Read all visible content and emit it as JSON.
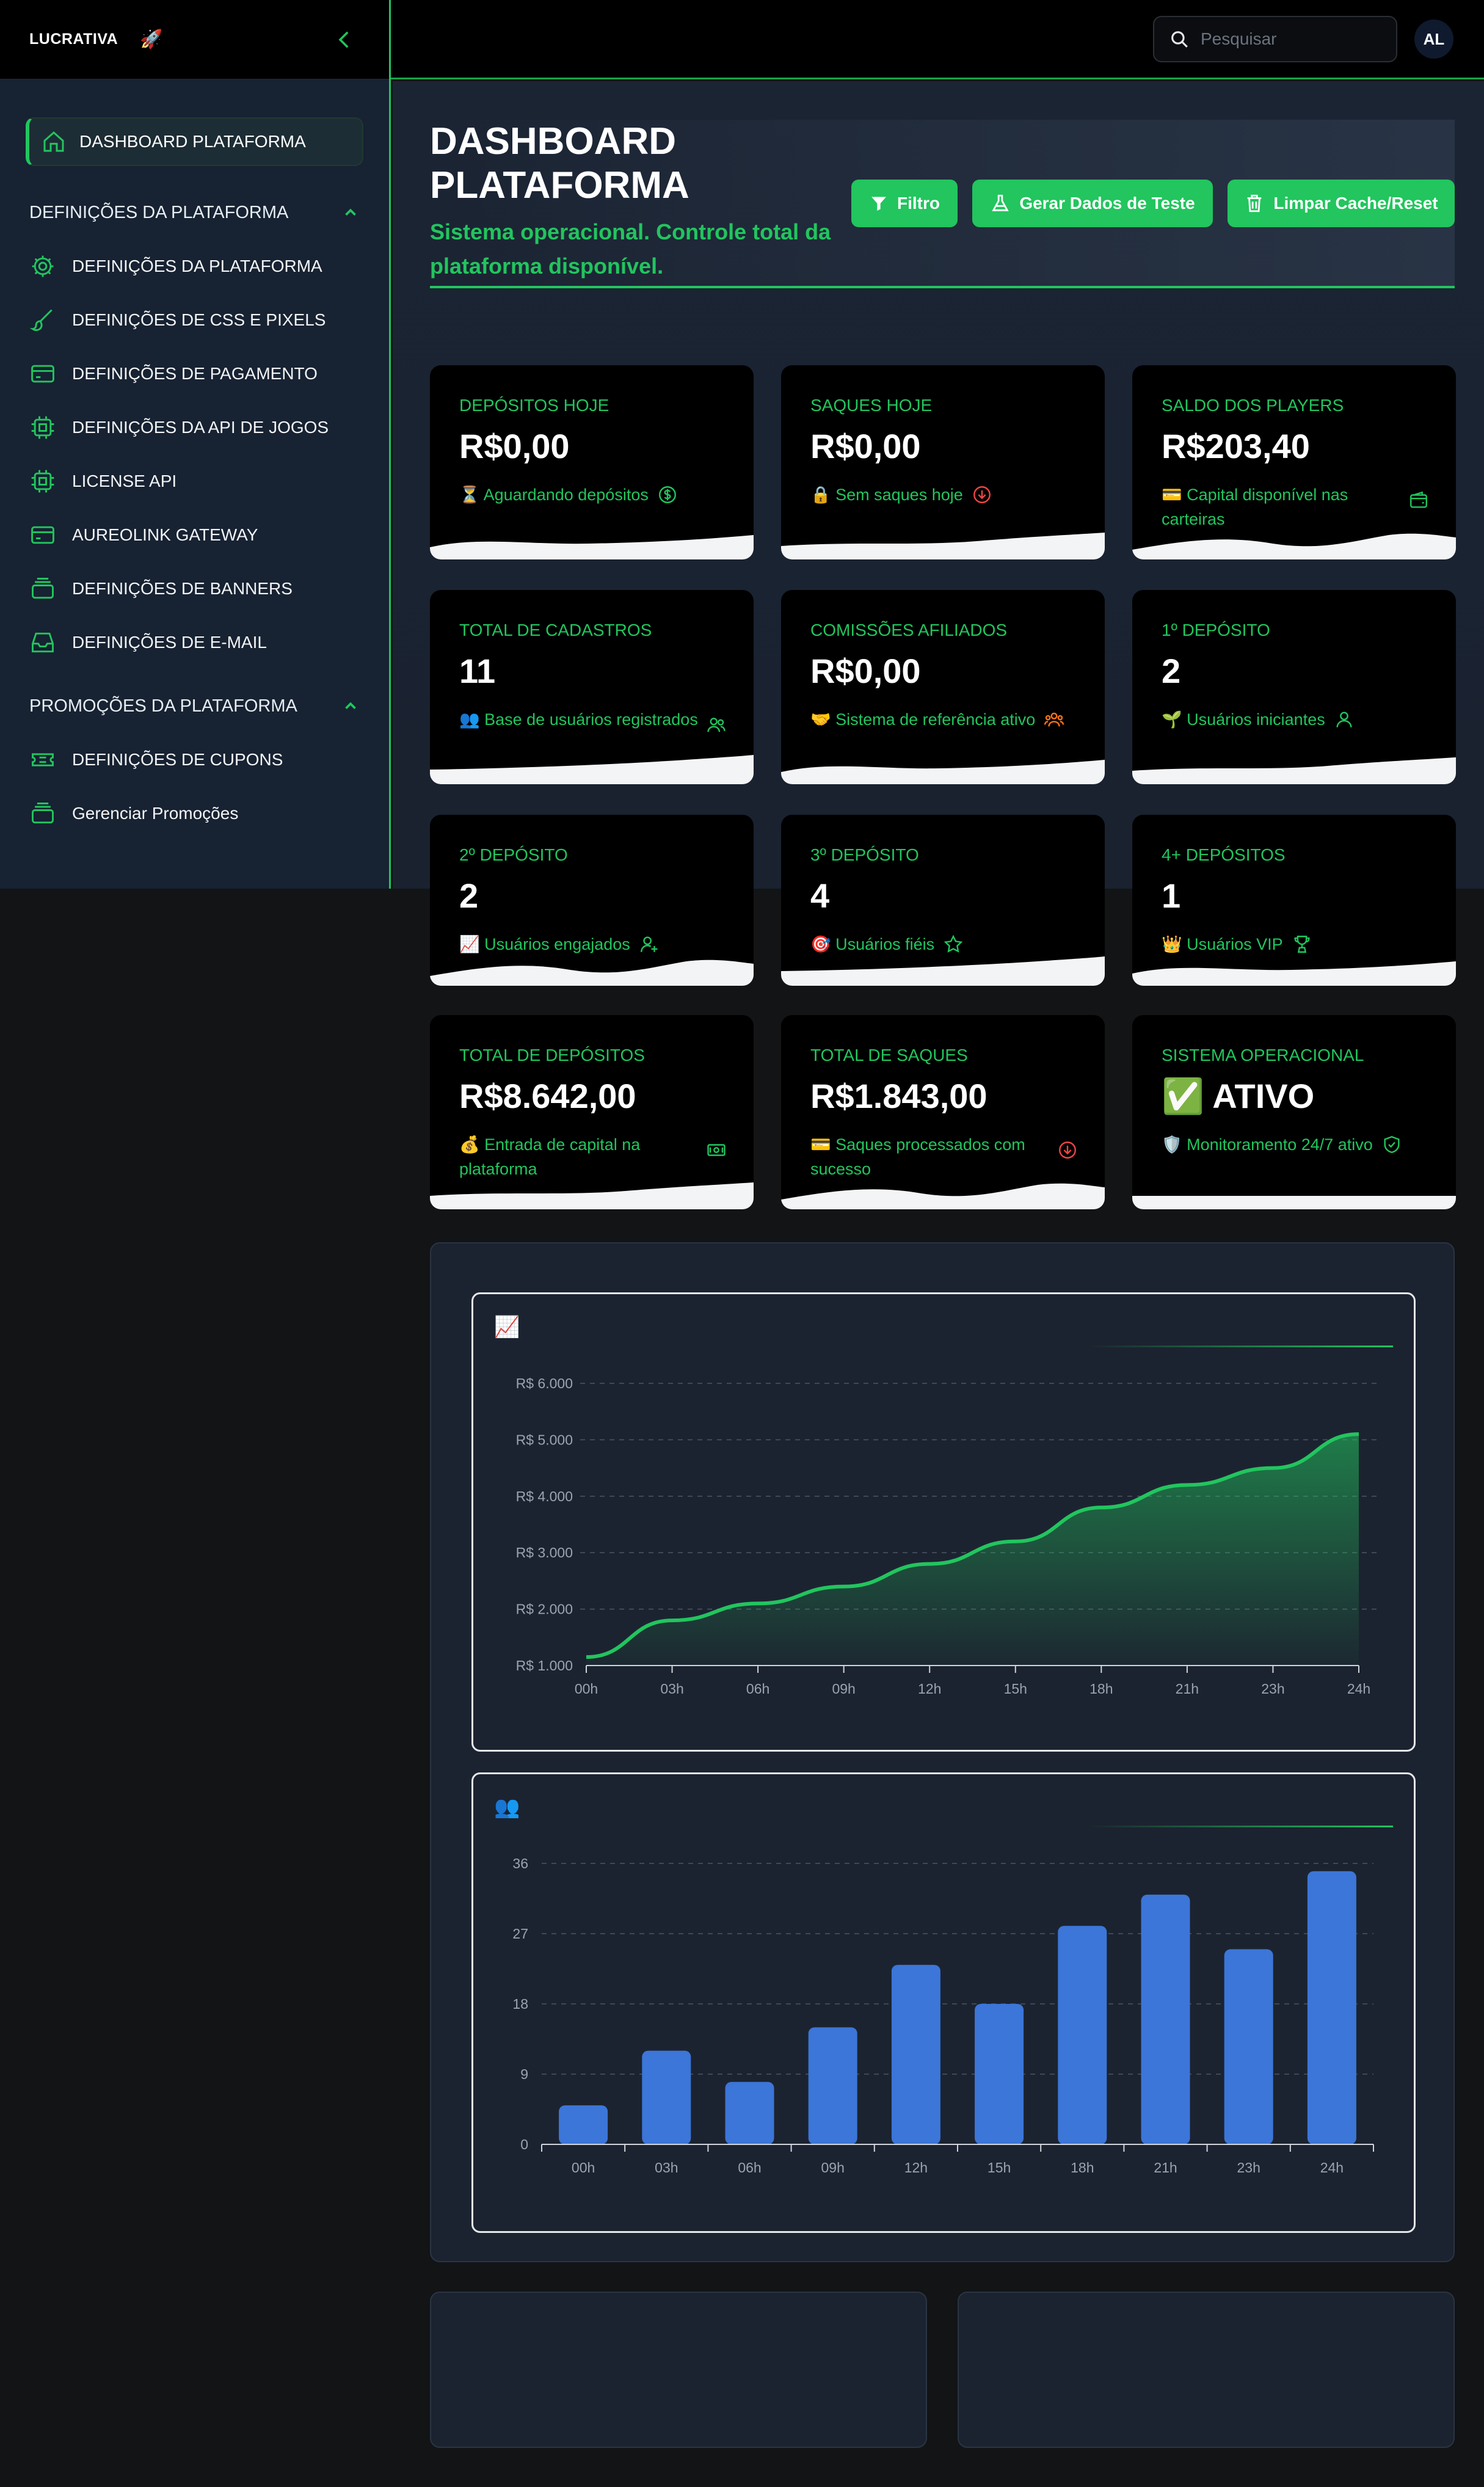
{
  "brand": {
    "logo": "LUCRATIVA",
    "logo_icon": "rocket-icon"
  },
  "topbar": {
    "search_placeholder": "Pesquisar",
    "avatar_initials": "AL"
  },
  "sidebar": {
    "active_item": "DASHBOARD PLATAFORMA",
    "sections": [
      {
        "title": "DEFINIÇÕES DA PLATAFORMA",
        "items": [
          {
            "label": "DEFINIÇÕES DA PLATAFORMA",
            "icon": "gear-icon"
          },
          {
            "label": "DEFINIÇÕES DE CSS E PIXELS",
            "icon": "brush-icon"
          },
          {
            "label": "DEFINIÇÕES DE PAGAMENTO",
            "icon": "credit-card-icon"
          },
          {
            "label": "DEFINIÇÕES DA API DE JOGOS",
            "icon": "chip-icon"
          },
          {
            "label": "LICENSE API",
            "icon": "chip-icon"
          },
          {
            "label": "AUREOLINK GATEWAY",
            "icon": "credit-card-icon"
          },
          {
            "label": "DEFINIÇÕES DE BANNERS",
            "icon": "layers-icon"
          },
          {
            "label": "DEFINIÇÕES DE E-MAIL",
            "icon": "inbox-icon"
          }
        ]
      },
      {
        "title": "PROMOÇÕES DA PLATAFORMA",
        "items": [
          {
            "label": "DEFINIÇÕES DE CUPONS",
            "icon": "ticket-icon"
          },
          {
            "label": "Gerenciar Promoções",
            "icon": "layers-icon"
          }
        ]
      }
    ]
  },
  "header": {
    "title": "DASHBOARD PLATAFORMA",
    "subtitle": "Sistema operacional. Controle total da plataforma disponível.",
    "buttons": {
      "filter": "Filtro",
      "test_data": "Gerar Dados de Teste",
      "clear_cache": "Limpar Cache/Reset"
    }
  },
  "cards": [
    {
      "label": "DEPÓSITOS HOJE",
      "value": "R$0,00",
      "desc": "⏳ Aguardando depósitos",
      "icon": "dollar-circle-icon"
    },
    {
      "label": "SAQUES HOJE",
      "value": "R$0,00",
      "desc": "🔒 Sem saques hoje",
      "icon": "arrow-down-circle-icon"
    },
    {
      "label": "SALDO DOS PLAYERS",
      "value": "R$203,40",
      "desc": "💳 Capital disponível nas carteiras",
      "icon": "wallet-icon"
    },
    {
      "label": "TOTAL DE CADASTROS",
      "value": "11",
      "desc": "👥 Base de usuários registrados",
      "icon": "users-icon"
    },
    {
      "label": "COMISSÕES AFILIADOS",
      "value": "R$0,00",
      "desc": "🤝 Sistema de referência ativo",
      "icon": "user-group-icon"
    },
    {
      "label": "1º DEPÓSITO",
      "value": "2",
      "desc": "🌱 Usuários iniciantes",
      "icon": "user-icon"
    },
    {
      "label": "2º DEPÓSITO",
      "value": "2",
      "desc": "📈 Usuários engajados",
      "icon": "user-plus-icon"
    },
    {
      "label": "3º DEPÓSITO",
      "value": "4",
      "desc": "🎯 Usuários fiéis",
      "icon": "star-icon"
    },
    {
      "label": "4+ DEPÓSITOS",
      "value": "1",
      "desc": "👑 Usuários VIP",
      "icon": "trophy-icon"
    },
    {
      "label": "TOTAL DE DEPÓSITOS",
      "value": "R$8.642,00",
      "desc": "💰 Entrada de capital na plataforma",
      "icon": "cash-icon"
    },
    {
      "label": "TOTAL DE SAQUES",
      "value": "R$1.843,00",
      "desc": "💳 Saques processados com sucesso",
      "icon": "arrow-down-circle-icon"
    },
    {
      "label": "SISTEMA OPERACIONAL",
      "value": "✅ ATIVO",
      "desc": "🛡️ Monitoramento 24/7 ativo",
      "icon": "shield-check-icon"
    }
  ],
  "chart_data": [
    {
      "type": "area",
      "icon_emoji": "📈",
      "x": [
        "00h",
        "03h",
        "06h",
        "09h",
        "12h",
        "15h",
        "18h",
        "21h",
        "23h",
        "24h"
      ],
      "values": [
        1150,
        1800,
        2100,
        2400,
        2800,
        3200,
        3800,
        4200,
        4500,
        5100
      ],
      "y_ticks": [
        "R$ 1.000",
        "R$ 2.000",
        "R$ 3.000",
        "R$ 4.000",
        "R$ 5.000",
        "R$ 6.000"
      ],
      "ylim": [
        1000,
        6000
      ],
      "grid": true,
      "color": "#22c55e"
    },
    {
      "type": "bar",
      "icon_emoji": "👥",
      "categories": [
        "00h",
        "03h",
        "06h",
        "09h",
        "12h",
        "15h",
        "18h",
        "21h",
        "23h",
        "24h"
      ],
      "values": [
        5,
        12,
        8,
        15,
        23,
        18,
        28,
        32,
        25,
        35
      ],
      "y_ticks": [
        "0",
        "9",
        "18",
        "27",
        "36"
      ],
      "ylim": [
        0,
        36
      ],
      "grid": true,
      "color": "#3b76d8"
    }
  ],
  "colors": {
    "accent": "#22c55e",
    "sidebar_bg": "#172232",
    "panel_bg": "#1c2330"
  }
}
